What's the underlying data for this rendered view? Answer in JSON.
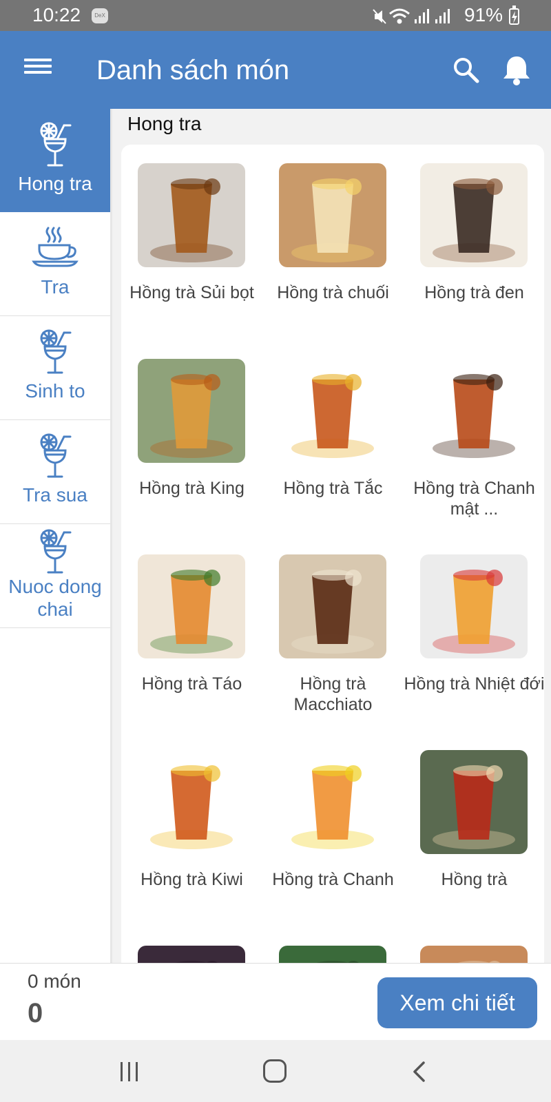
{
  "status_bar": {
    "time": "10:22",
    "dex_badge": "DeX",
    "battery": "91%"
  },
  "app_bar": {
    "title": "Danh sách món",
    "icons": [
      "menu-icon",
      "search-icon",
      "bell-icon"
    ]
  },
  "colors": {
    "primary": "#4a80c3",
    "status_bar": "#757575",
    "background": "#f2f2f2"
  },
  "categories": [
    {
      "label": "Hong tra",
      "icon": "cocktail-icon",
      "active": true
    },
    {
      "label": "Tra",
      "icon": "coffee-cup-icon",
      "active": false
    },
    {
      "label": "Sinh to",
      "icon": "cocktail-icon",
      "active": false
    },
    {
      "label": "Tra sua",
      "icon": "cocktail-icon",
      "active": false
    },
    {
      "label": "Nuoc dong chai",
      "icon": "cocktail-icon",
      "active": false
    }
  ],
  "section_title": "Hong tra",
  "menu_items": [
    {
      "name": "Hồng trà Sủi bọt"
    },
    {
      "name": "Hồng trà chuối"
    },
    {
      "name": "Hồng trà đen"
    },
    {
      "name": "Hồng trà King"
    },
    {
      "name": "Hồng trà Tắc"
    },
    {
      "name": "Hồng trà Chanh mật ..."
    },
    {
      "name": "Hồng trà Táo"
    },
    {
      "name": "Hồng trà Macchiato"
    },
    {
      "name": "Hồng trà Nhiệt đới"
    },
    {
      "name": "Hồng trà Kiwi"
    },
    {
      "name": "Hồng trà Chanh"
    },
    {
      "name": "Hồng trà"
    },
    {
      "name": ""
    },
    {
      "name": ""
    },
    {
      "name": ""
    }
  ],
  "bottom_bar": {
    "item_count": "0 món",
    "total": "0",
    "detail_button": "Xem chi tiết"
  },
  "nav_bar": {
    "icons": [
      "recent-apps-icon",
      "home-icon",
      "back-icon"
    ]
  }
}
